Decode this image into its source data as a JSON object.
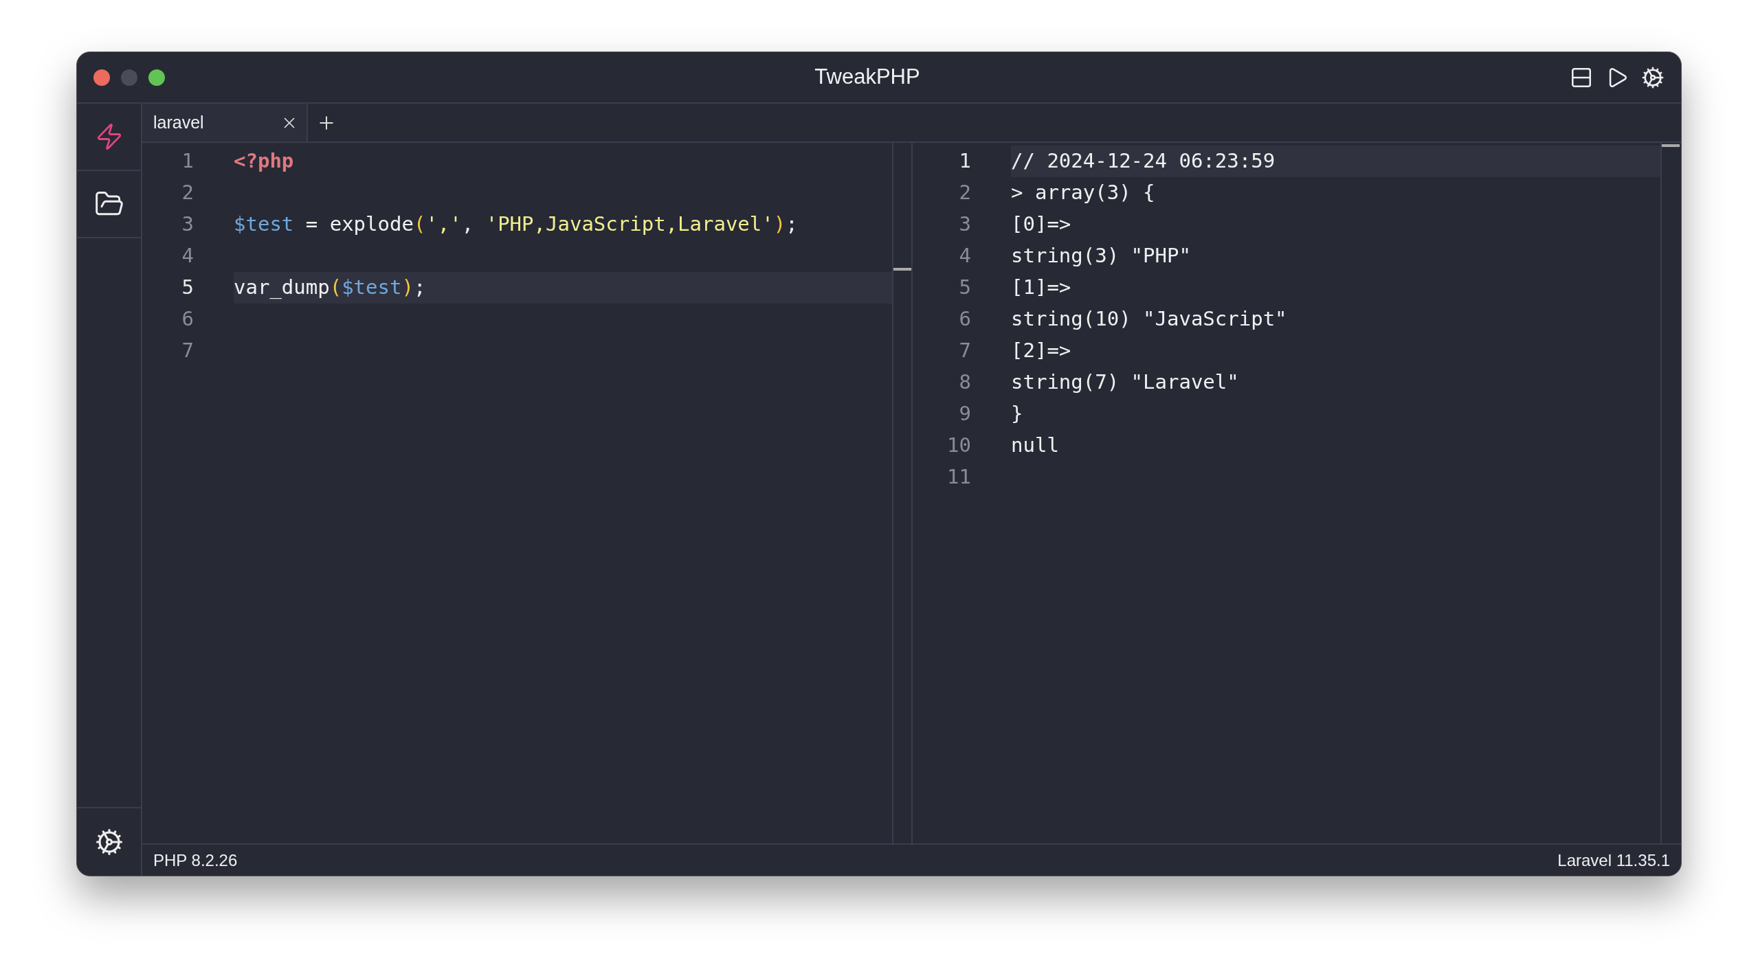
{
  "window": {
    "title": "TweakPHP"
  },
  "tabs": [
    {
      "label": "laravel",
      "selected": true
    }
  ],
  "editor": {
    "lines": [
      {
        "number": "1",
        "active": false,
        "tokens": [
          {
            "kind": "keyword",
            "text": "<?php"
          }
        ]
      },
      {
        "number": "2",
        "active": false
      },
      {
        "number": "3",
        "active": false,
        "tokens": [
          {
            "kind": "variable",
            "text": "$test"
          },
          {
            "kind": "plain",
            "text": " = explode"
          },
          {
            "kind": "paren",
            "text": "("
          },
          {
            "kind": "string",
            "text": "','"
          },
          {
            "kind": "plain",
            "text": ", "
          },
          {
            "kind": "string",
            "text": "'PHP,JavaScript,Laravel'"
          },
          {
            "kind": "paren",
            "text": ")"
          },
          {
            "kind": "plain",
            "text": ";"
          }
        ]
      },
      {
        "number": "4",
        "active": false
      },
      {
        "number": "5",
        "active": true,
        "tokens": [
          {
            "kind": "plain",
            "text": "var_dump"
          },
          {
            "kind": "paren",
            "text": "("
          },
          {
            "kind": "variable",
            "text": "$test"
          },
          {
            "kind": "paren",
            "text": ")"
          },
          {
            "kind": "plain",
            "text": ";"
          }
        ]
      },
      {
        "number": "6",
        "active": false
      },
      {
        "number": "7",
        "active": false
      }
    ]
  },
  "output": {
    "lines": [
      {
        "number": "1",
        "active": true,
        "tokens": [
          {
            "kind": "plain",
            "text": "// 2024-12-24 06:23:59"
          }
        ]
      },
      {
        "number": "2",
        "active": false,
        "tokens": [
          {
            "kind": "plain",
            "text": "> array(3) {"
          }
        ]
      },
      {
        "number": "3",
        "active": false,
        "tokens": [
          {
            "kind": "plain",
            "text": "[0]=>"
          }
        ]
      },
      {
        "number": "4",
        "active": false,
        "tokens": [
          {
            "kind": "plain",
            "text": "string(3) \"PHP\""
          }
        ]
      },
      {
        "number": "5",
        "active": false,
        "tokens": [
          {
            "kind": "plain",
            "text": "[1]=>"
          }
        ]
      },
      {
        "number": "6",
        "active": false,
        "tokens": [
          {
            "kind": "plain",
            "text": "string(10) \"JavaScript\""
          }
        ]
      },
      {
        "number": "7",
        "active": false,
        "tokens": [
          {
            "kind": "plain",
            "text": "[2]=>"
          }
        ]
      },
      {
        "number": "8",
        "active": false,
        "tokens": [
          {
            "kind": "plain",
            "text": "string(7) \"Laravel\""
          }
        ]
      },
      {
        "number": "9",
        "active": false,
        "tokens": [
          {
            "kind": "plain",
            "text": "}"
          }
        ]
      },
      {
        "number": "10",
        "active": false,
        "tokens": [
          {
            "kind": "plain",
            "text": "null"
          }
        ]
      },
      {
        "number": "11",
        "active": false
      }
    ]
  },
  "status_bar": {
    "php_version": "PHP 8.2.26",
    "laravel_version": "Laravel 11.35.1"
  }
}
